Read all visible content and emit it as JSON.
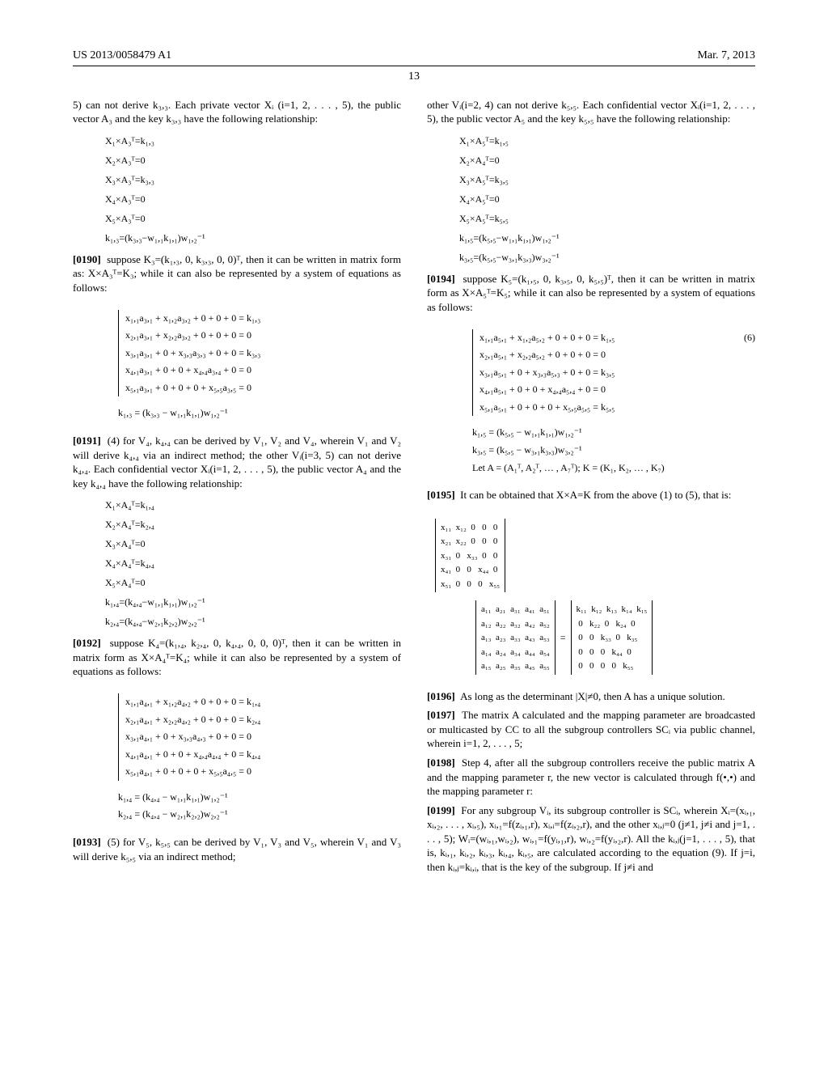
{
  "header": {
    "pubno": "US 2013/0058479 A1",
    "date": "Mar. 7, 2013"
  },
  "pagenum": "13",
  "left": {
    "intro": "5) can not derive k₃,₃. Each private vector Xᵢ (i=1, 2, . . . , 5), the public vector A₃ and the key k₃,₃ have the following relationship:",
    "eqA": [
      "X₁×A₃ᵀ=k₁,₃",
      "X₂×A₃ᵀ=0",
      "X₃×A₃ᵀ=k₃,₃",
      "X₄×A₃ᵀ=0",
      "X₅×A₃ᵀ=0",
      "k₁,₃=(k₃,₃−w₁,₁k₁,₁)w₁,₂⁻¹"
    ],
    "p0190": "suppose K₃=(k₁,₃, 0, k₃,₃, 0, 0)ᵀ, then it can be written in matrix form as: X×A₃ᵀ=K₃; while it can also be represented by a system of equations as follows:",
    "sysA": [
      "x₁,₁a₃,₁ + x₁,₂a₃,₂ + 0 + 0 + 0 = k₁,₃",
      "x₂,₁a₃,₁ + x₂,₂a₃,₂ + 0 + 0 + 0 = 0",
      "x₃,₁a₃,₁ + 0 + x₃,₃a₃,₃ + 0 + 0 = k₃,₃",
      "x₄,₁a₃,₁ + 0 + 0 + x₄,₄a₃,₄ + 0 = 0",
      "x₅,₁a₃,₁ + 0 + 0 + 0 + x₅,₅a₃,₅ = 0"
    ],
    "sysAtail": "k₁,₃ = (k₃,₃ − w₁,₁k₁,₁)w₁,₂⁻¹",
    "p0191": "(4) for V₄, k₄,₄ can be derived by V₁, V₂ and V₄, wherein V₁ and V₂ will derive k₄,₄ via an indirect method; the other Vᵢ(i=3, 5) can not derive k₄,₄. Each confidential vector Xᵢ(i=1, 2, . . . , 5), the public vector A₄ and the key k₄,₄ have the following relationship:",
    "eqB": [
      "X₁×A₄ᵀ=k₁,₄",
      "X₂×A₄ᵀ=k₂,₄",
      "X₃×A₄ᵀ=0",
      "X₄×A₄ᵀ=k₄,₄",
      "X₅×A₄ᵀ=0",
      "k₁,₄=(k₄,₄−w₁,₁k₁,₁)w₁,₂⁻¹",
      "k₂,₄=(k₄,₄−w₂,₁k₂,₂)w₂,₂⁻¹"
    ],
    "p0192": "suppose K₄=(k₁,₄, k₂,₄, 0, k₄,₄, 0, 0, 0)ᵀ, then it can be written in matrix form as X×A₄ᵀ=K₄; while it can also be represented by a system of equations as follows:",
    "sysB": [
      "x₁,₁a₄,₁ + x₁,₂a₄,₂ + 0 + 0 + 0 = k₁,₄",
      "x₂,₁a₄,₁ + x₂,₂a₄,₂ + 0 + 0 + 0 = k₂,₄",
      "x₃,₁a₄,₁ + 0 + x₃,₃a₄,₃ + 0 + 0 = 0",
      "x₄,₁a₄,₁ + 0 + 0 + x₄,₄a₄,₄ + 0 = k₄,₄",
      "x₅,₁a₄,₁ + 0 + 0 + 0 + x₅,₅a₄,₅ = 0"
    ],
    "sysBtail": [
      "k₁,₄ = (k₄,₄ − w₁,₁k₁,₁)w₁,₂⁻¹",
      "k₂,₄ = (k₄,₄ − w₂,₁k₂,₂)w₂,₂⁻¹"
    ],
    "p0193": "(5) for V₅, k₅,₅ can be derived by V₁, V₃ and V₅, wherein V₁ and V₃ will derive k₅,₅ via an indirect method;"
  },
  "right": {
    "intro": "other Vᵢ(i=2, 4) can not derive k₅,₅. Each confidential vector Xᵢ(i=1, 2, . . . , 5), the public vector A₅ and the key k₅,₅ have the following relationship:",
    "eqC": [
      "X₁×A₅ᵀ=k₁,₅",
      "X₂×A₄ᵀ=0",
      "X₃×A₅ᵀ=k₃,₅",
      "X₄×A₅ᵀ=0",
      "X₅×A₅ᵀ=k₅,₅",
      "k₁,₅=(k₅,₅−w₁,₁k₁,₁)w₁,₂⁻¹",
      "k₃,₅=(k₅,₅−w₃,₁k₃,₃)w₃,₂⁻¹"
    ],
    "p0194": "suppose K₅=(k₁,₅, 0, k₃,₅, 0, k₅,₅)ᵀ, then it can be written in matrix form as X×A₅ᵀ=K₅; while it can also be represented by a system of equations as follows:",
    "sysCnum": "(6)",
    "sysC": [
      "x₁,₁a₅,₁ + x₁,₂a₅,₂ + 0 + 0 + 0 = k₁,₅",
      "x₂,₁a₅,₁ + x₂,₂a₅,₂ + 0 + 0 + 0 = 0",
      "x₃,₁a₅,₁ + 0 + x₃,₃a₅,₃ + 0 + 0 = k₃,₅",
      "x₄,₁a₅,₁ + 0 + 0 + x₄,₄a₅,₄ + 0 = 0",
      "x₅,₁a₅,₁ + 0 + 0 + 0 + x₅,₅a₅,₅ = k₅,₅"
    ],
    "sysCtail": [
      "k₁,₅ = (k₅,₅ − w₁,₁k₁,₁)w₁,₂⁻¹",
      "k₃,₅ = (k₅,₅ − w₃,₁k₃,₃)w₃,₂⁻¹",
      "Let A = (A₁ᵀ, A₂ᵀ, … , A₇ᵀ); K = (K₁, K₂, … , K₇)"
    ],
    "p0195": "It can be obtained that X×A=K from the above (1) to (5), that is:",
    "matX": "x₁₁  x₁₂  0   0   0\nx₂₁  x₂₂  0   0   0\nx₃₁  0   x₃₃  0   0\nx₄₁  0   0   x₄₄  0\nx₅₁  0   0   0   x₅₅",
    "matA": "a₁₁  a₂₁  a₃₁  a₄₁  a₅₁\na₁₂  a₂₂  a₃₂  a₄₂  a₅₂\na₁₃  a₂₃  a₃₃  a₄₃  a₅₃\na₁₄  a₂₄  a₃₄  a₄₄  a₅₄\na₁₅  a₂₅  a₃₅  a₄₅  a₅₅",
    "matK": "k₁₁  k₁₂  k₁₃  k₁₄  k₁₅\n 0   k₂₂  0   k₂₄  0\n 0   0   k₃₃  0   k₃₅\n 0   0   0   k₄₄  0\n 0   0   0   0   k₅₅",
    "eq_mid": "=",
    "p0196": "As long as the determinant |X|≠0, then A has a unique solution.",
    "p0197": "The matrix A calculated and the mapping parameter are broadcasted or multicasted by CC to all the subgroup controllers SCᵢ via public channel, wherein i=1, 2, . . . , 5;",
    "p0198": "Step 4, after all the subgroup controllers receive the public matrix A and the mapping parameter r, the new vector is calculated through f(•,•) and the mapping parameter r:",
    "p0199": "For any subgroup Vᵢ, its subgroup controller is SCᵢ, wherein Xᵢ=(xᵢ,₁, xᵢ,₂, . . . , xᵢ,₅), xᵢ,₁=f(zᵢ,₁,r), xᵢ,ᵢ=f(zᵢ,₂,r), and the other xᵢ,ⱼ=0 (j≠1, j≠i and j=1, . . . , 5); Wᵢ=(wᵢ,₁,wᵢ,₂), wᵢ,₁=f(yᵢ,₁,r), wᵢ,₂=f(yᵢ,₂,r). All the kᵢ,ⱼ(j=1, . . . , 5), that is, kᵢ,₁, kᵢ,₂, kᵢ,₃, kᵢ,₄, kᵢ,₅, are calculated according to the equation (9). If j=i, then kᵢ,ⱼ=kᵢ,ᵢ, that is the key of the subgroup. If j≠i and"
  },
  "parnums": {
    "p0190": "[0190]",
    "p0191": "[0191]",
    "p0192": "[0192]",
    "p0193": "[0193]",
    "p0194": "[0194]",
    "p0195": "[0195]",
    "p0196": "[0196]",
    "p0197": "[0197]",
    "p0198": "[0198]",
    "p0199": "[0199]"
  }
}
